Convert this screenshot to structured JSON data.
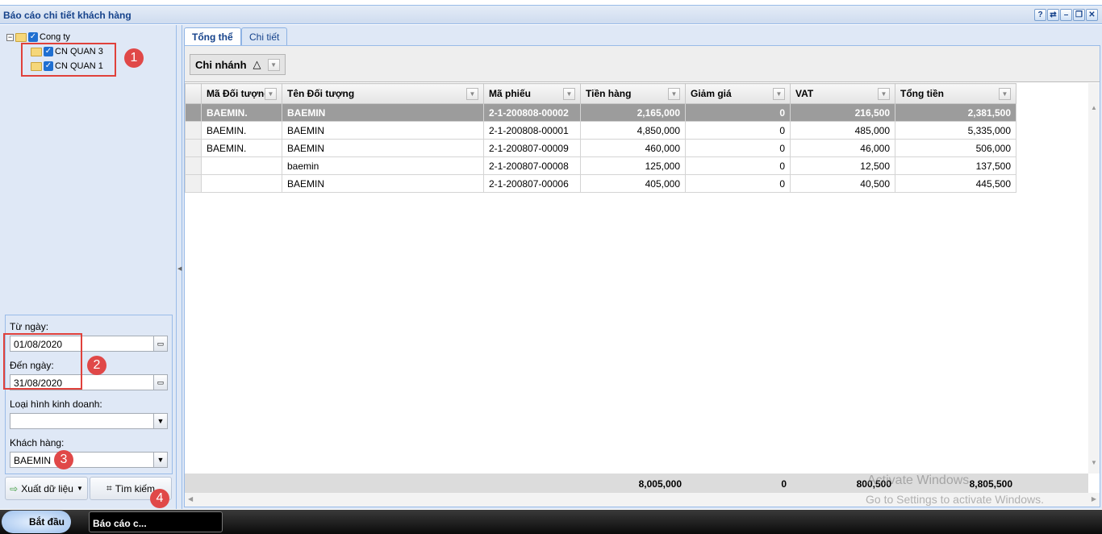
{
  "window": {
    "title": "Báo cáo chi tiết khách hàng",
    "buttons": [
      "?",
      "⇄",
      "–",
      "❐",
      "✕"
    ]
  },
  "tree": {
    "root": "Cong ty",
    "children": [
      "CN QUAN 3",
      "CN QUAN 1"
    ]
  },
  "filters": {
    "from_label": "Từ ngày:",
    "from_value": "01/08/2020",
    "to_label": "Đến ngày:",
    "to_value": "31/08/2020",
    "biz_label": "Loại hình kinh doanh:",
    "biz_value": "",
    "cust_label": "Khách hàng:",
    "cust_value": "BAEMIN"
  },
  "buttons": {
    "export": "Xuất dữ liệu",
    "search": "Tìm kiếm"
  },
  "badges": [
    "1",
    "2",
    "3",
    "4"
  ],
  "tabs": [
    {
      "label": "Tổng thể",
      "active": true
    },
    {
      "label": "Chi tiết",
      "active": false
    }
  ],
  "group": {
    "label": "Chi nhánh",
    "sort": "△"
  },
  "grid": {
    "columns": [
      "Mã Đối tượng",
      "Tên Đối tượng",
      "Mã phiếu",
      "Tiền hàng",
      "Giảm giá",
      "VAT",
      "Tổng tiền"
    ],
    "rows": [
      [
        "BAEMIN.",
        "BAEMIN",
        "2-1-200808-00002",
        "2,165,000",
        "0",
        "216,500",
        "2,381,500"
      ],
      [
        "BAEMIN.",
        "BAEMIN",
        "2-1-200808-00001",
        "4,850,000",
        "0",
        "485,000",
        "5,335,000"
      ],
      [
        "BAEMIN.",
        "BAEMIN",
        "2-1-200807-00009",
        "460,000",
        "0",
        "46,000",
        "506,000"
      ],
      [
        "",
        "baemin",
        "2-1-200807-00008",
        "125,000",
        "0",
        "12,500",
        "137,500"
      ],
      [
        "",
        "BAEMIN",
        "2-1-200807-00006",
        "405,000",
        "0",
        "40,500",
        "445,500"
      ]
    ],
    "totals": {
      "tien_hang": "8,005,000",
      "giam_gia": "0",
      "vat": "800,500",
      "tong_tien": "8,805,500"
    }
  },
  "watermark": {
    "line1": "Activate Windows",
    "line2": "Go to Settings to activate Windows."
  },
  "taskbar": {
    "start": "Bắt đầu",
    "task": "Báo cáo c..."
  }
}
